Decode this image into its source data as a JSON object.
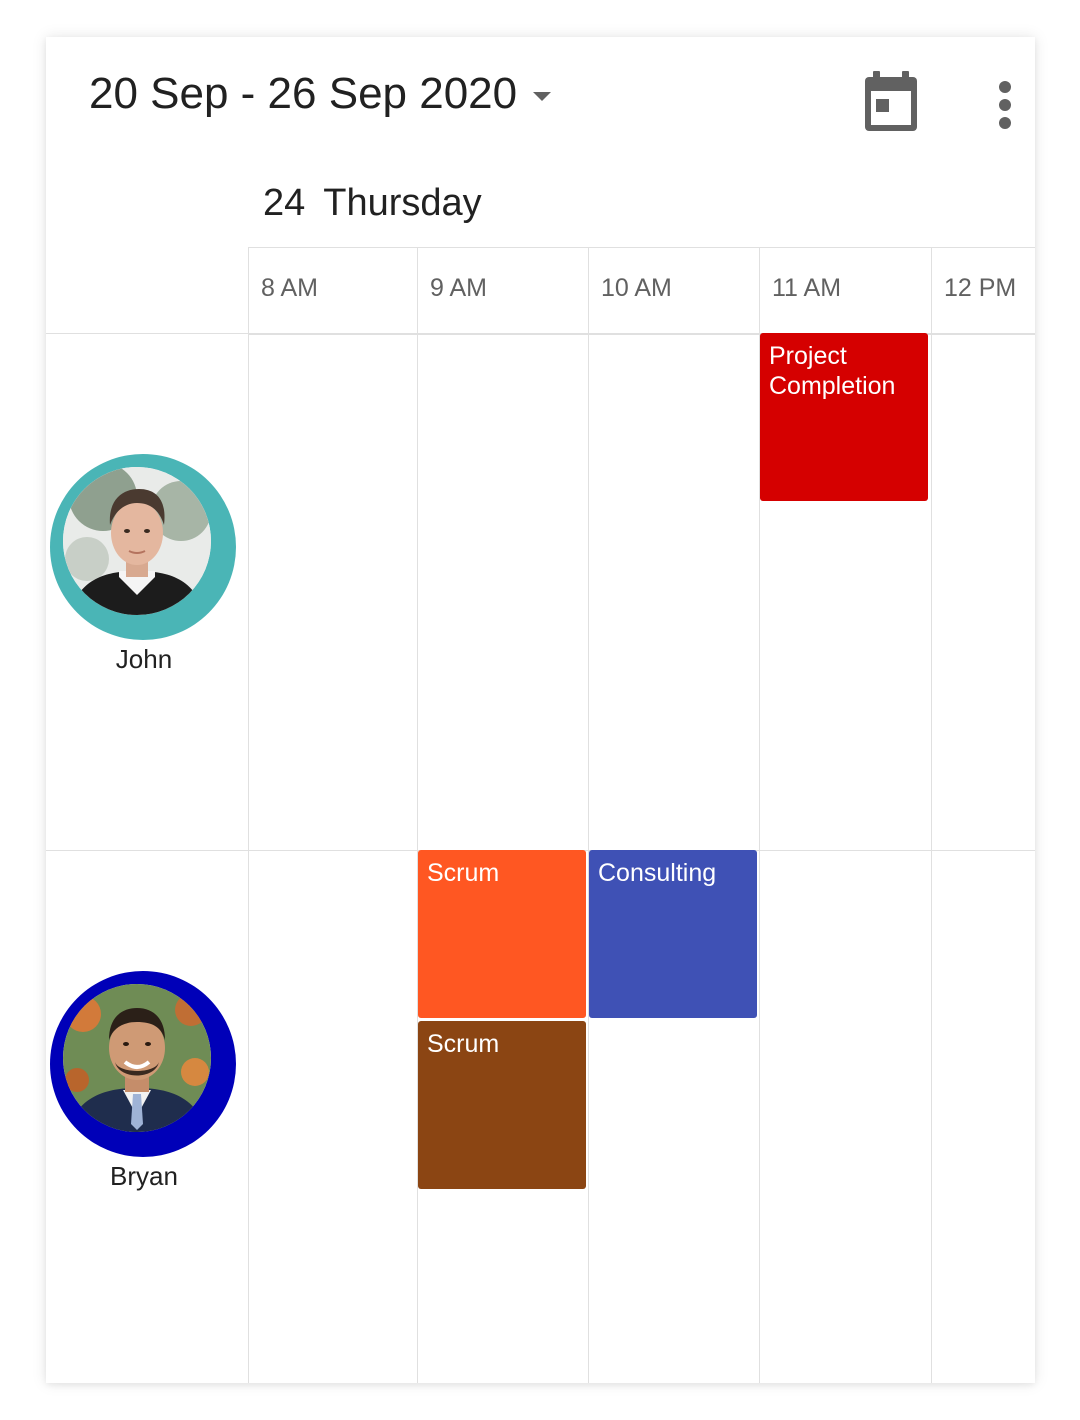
{
  "header": {
    "date_range": "20 Sep - 26 Sep 2020",
    "today_icon": "calendar-today-icon",
    "more_icon": "more-vert-icon"
  },
  "day": {
    "number": "24",
    "name": "Thursday"
  },
  "time_slots": [
    "8 AM",
    "9 AM",
    "10 AM",
    "11 AM",
    "12 PM"
  ],
  "resources": [
    {
      "name": "John",
      "ring_color": "#4AB5B6"
    },
    {
      "name": "Bryan",
      "ring_color": "#0000B8"
    }
  ],
  "appointments": [
    {
      "subject": "Project Completion",
      "resource": "John",
      "start": "11 AM",
      "end": "12 PM",
      "color": "#D50000"
    },
    {
      "subject": "Scrum",
      "resource": "Bryan",
      "start": "9 AM",
      "end": "10 AM",
      "color": "#FF5722"
    },
    {
      "subject": "Consulting",
      "resource": "Bryan",
      "start": "10 AM",
      "end": "11 AM",
      "color": "#3F51B5"
    },
    {
      "subject": "Scrum",
      "resource": "Bryan",
      "start": "9 AM",
      "end": "10 AM",
      "color": "#8B4513"
    }
  ],
  "colors": {
    "grid_line": "#E0E0E0",
    "text_primary": "#212121",
    "text_secondary": "#616161",
    "icon": "#616161"
  }
}
